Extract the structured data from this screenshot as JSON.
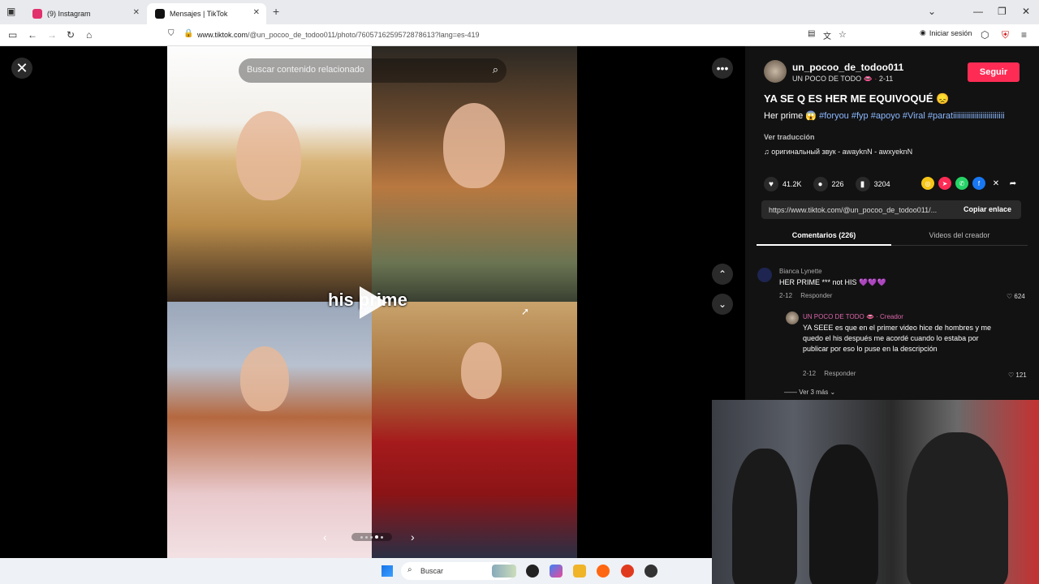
{
  "browser": {
    "tabs": [
      {
        "label": "(9) Instagram",
        "favicon_color": "#e1306c"
      },
      {
        "label": "Mensajes | TikTok",
        "favicon_color": "#111111"
      }
    ],
    "url_host": "www.tiktok.com",
    "url_path": "/@un_pocoo_de_todoo011/photo/7605716259572878613?lang=es-419",
    "signin_label": "Iniciar sesión",
    "newtab_label": "+"
  },
  "viewer": {
    "search_placeholder": "Buscar contenido relacionado",
    "overlay_text": "his prime",
    "close_label": "✕",
    "more_label": "•••",
    "prev_label": "‹",
    "next_label": "›",
    "up_label": "⌃",
    "down_label": "⌄",
    "photo_count": 5,
    "current_photo": 4
  },
  "post": {
    "username": "un_pocoo_de_todoo011",
    "display_name": "UN POCO DE TODO",
    "date": "2-11",
    "follow_label": "Seguir",
    "title": "YA SE Q ES HER ME EQUIVOQUÉ 😞",
    "desc_prefix": "Her prime 😱",
    "hashtags": [
      "#foryou",
      "#fyp",
      "#apoyo",
      "#Viral",
      "#paratiiiiiiiiiiiiiiiiiiiiiiiiii"
    ],
    "translate_label": "Ver traducción",
    "sound": "оригинальный звук - awayknN - awxyeknN",
    "likes": "41.2K",
    "comments": "226",
    "saves": "3204",
    "link": "https://www.tiktok.com/@un_pocoo_de_todoo011/...",
    "copy_label": "Copiar enlace",
    "tab_comments": "Comentarios (226)",
    "tab_videos": "Videos del creador"
  },
  "comments": [
    {
      "name": "Bianca Lynette",
      "text": "HER PRIME *** not HIS 💜💜💜",
      "date": "2-12",
      "reply_label": "Responder",
      "likes": "624"
    },
    {
      "name": "UN POCO DE TODO 👄 · Creador",
      "text": "YA SEEE es que en el primer video hice de hombres y me quedo el his después me acordé cuando lo estaba por publicar por eso lo puse en la descripción",
      "date": "2-12",
      "reply_label": "Responder",
      "likes": "121"
    }
  ],
  "more_replies": "Ver 3 más",
  "taskbar": {
    "search_label": "Buscar"
  },
  "colors": {
    "accent": "#fe2c55",
    "hashtag": "#8bb8ff",
    "panel_bg": "#121212"
  }
}
